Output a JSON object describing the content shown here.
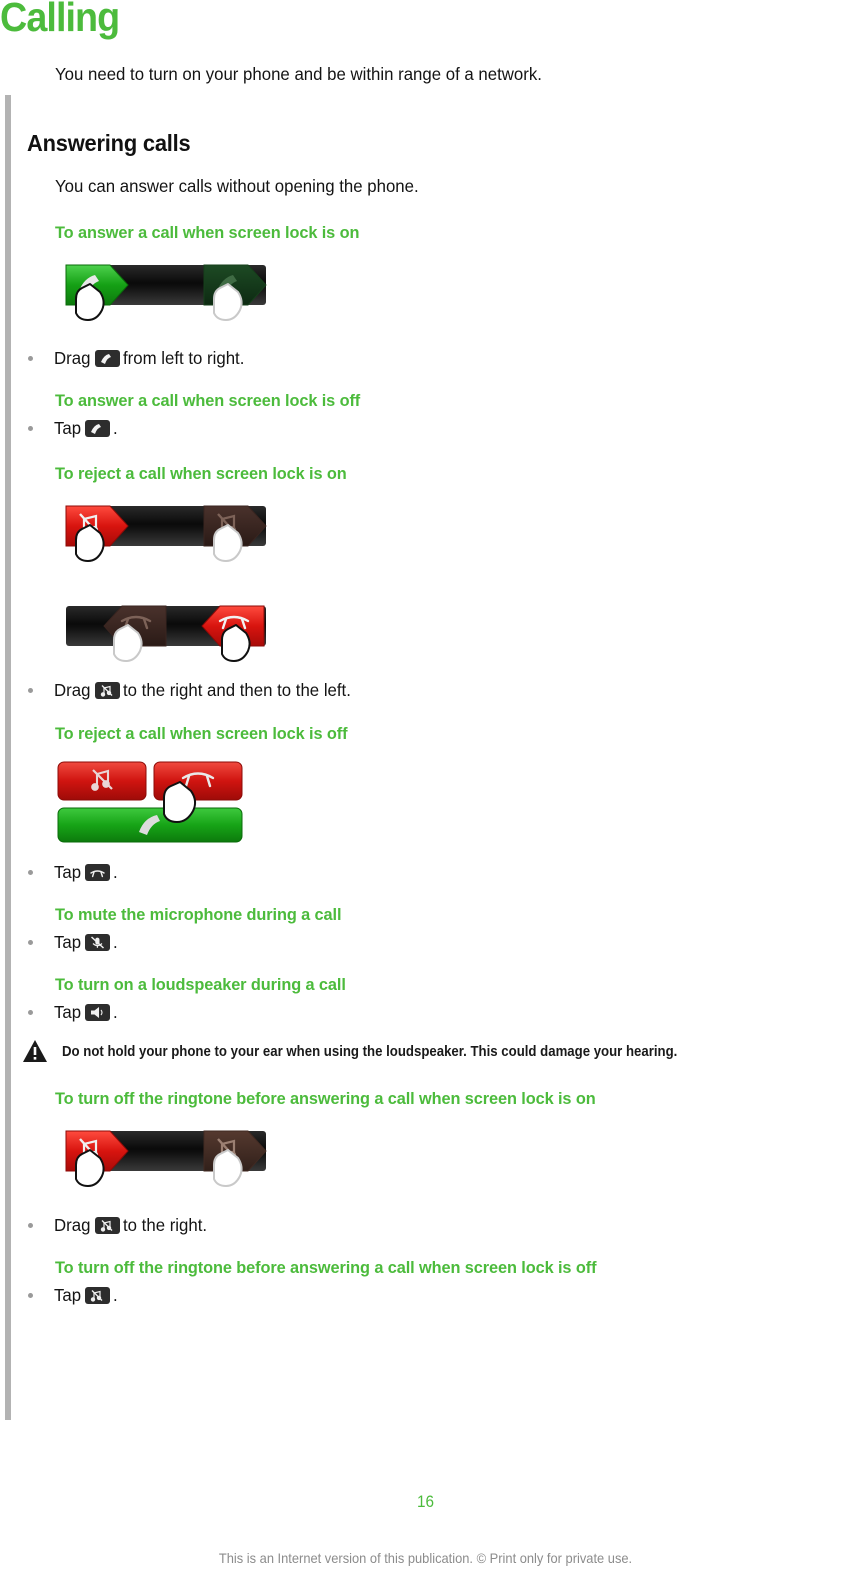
{
  "chapter": {
    "title": "Calling"
  },
  "intro": "You need to turn on your phone and be within range of a network.",
  "section": {
    "heading": "Answering calls",
    "intro": "You can answer calls without opening the phone."
  },
  "procedures": [
    {
      "heading": "To answer a call when screen lock is on",
      "illustration": "slider-answer-drag-right",
      "step_prefix": "Drag",
      "step_icon": "answer-call-icon",
      "step_suffix": "from left to right."
    },
    {
      "heading": "To answer a call when screen lock is off",
      "step_prefix": "Tap",
      "step_icon": "answer-call-icon",
      "step_suffix": "."
    },
    {
      "heading": "To reject a call when screen lock is on",
      "illustration": "slider-silence-then-reject",
      "step_prefix": "Drag",
      "step_icon": "silence-ringtone-icon",
      "step_suffix": "to the right and then to the left."
    },
    {
      "heading": "To reject a call when screen lock is off",
      "illustration": "buttons-silence-reject-answer",
      "step_prefix": "Tap",
      "step_icon": "end-call-icon",
      "step_suffix": "."
    },
    {
      "heading": "To mute the microphone during a call",
      "step_prefix": "Tap",
      "step_icon": "mute-microphone-icon",
      "step_suffix": "."
    },
    {
      "heading": "To turn on a loudspeaker during a call",
      "step_prefix": "Tap",
      "step_icon": "loudspeaker-icon",
      "step_suffix": "."
    },
    {
      "heading": "To turn off the ringtone before answering a call when screen lock is on",
      "illustration": "slider-silence-drag-right",
      "step_prefix": "Drag",
      "step_icon": "silence-ringtone-icon",
      "step_suffix": "to the right."
    },
    {
      "heading": "To turn off the ringtone before answering a call when screen lock is off",
      "step_prefix": "Tap",
      "step_icon": "silence-ringtone-icon",
      "step_suffix": "."
    }
  ],
  "warning": {
    "icon": "warning-triangle-icon",
    "text": "Do not hold your phone to your ear when using the loudspeaker. This could damage your hearing."
  },
  "footer": {
    "page_number": "16",
    "notice": "This is an Internet version of this publication. © Print only for private use."
  },
  "colors": {
    "accent_green": "#4CBB3C",
    "heading_black": "#111111",
    "rule_gray": "#b3b3b3",
    "footer_gray": "#8c8c8c",
    "reject_red": "#e0221f",
    "answer_green": "#2aa02a"
  }
}
